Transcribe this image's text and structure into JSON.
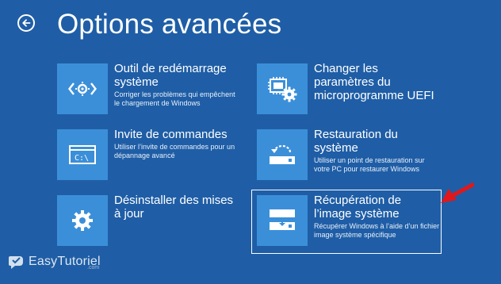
{
  "page": {
    "title": "Options avancées"
  },
  "options": [
    {
      "title": "Outil de redémarrage système",
      "description": "Corriger les problèmes qui empêchent le chargement de Windows",
      "icon": "code-brackets-icon"
    },
    {
      "title": "Changer les paramètres du microprogramme UEFI",
      "description": "",
      "icon": "chip-gear-icon"
    },
    {
      "title": "Invite de commandes",
      "description": "Utiliser l’invite de commandes pour un dépannage avancé",
      "icon": "command-prompt-icon"
    },
    {
      "title": "Restauration du système",
      "description": "Utiliser un point de restauration sur votre PC pour restaurer Windows",
      "icon": "restore-drive-icon"
    },
    {
      "title": "Désinstaller des mises à jour",
      "description": "",
      "icon": "gear-icon"
    },
    {
      "title": "Récupération de l’image système",
      "description": "Récupérer Windows à l’aide d’un fichier image système spécifique",
      "icon": "image-drive-icon",
      "selected": true
    }
  ],
  "watermark": {
    "brand": "EasyTutoriel",
    "sub": ".com",
    "icon": "speech-bubble-icon"
  },
  "colors": {
    "background": "#1f5ea6",
    "tile": "#3b8fd8",
    "text": "#ffffff",
    "arrow": "#e2171b"
  }
}
